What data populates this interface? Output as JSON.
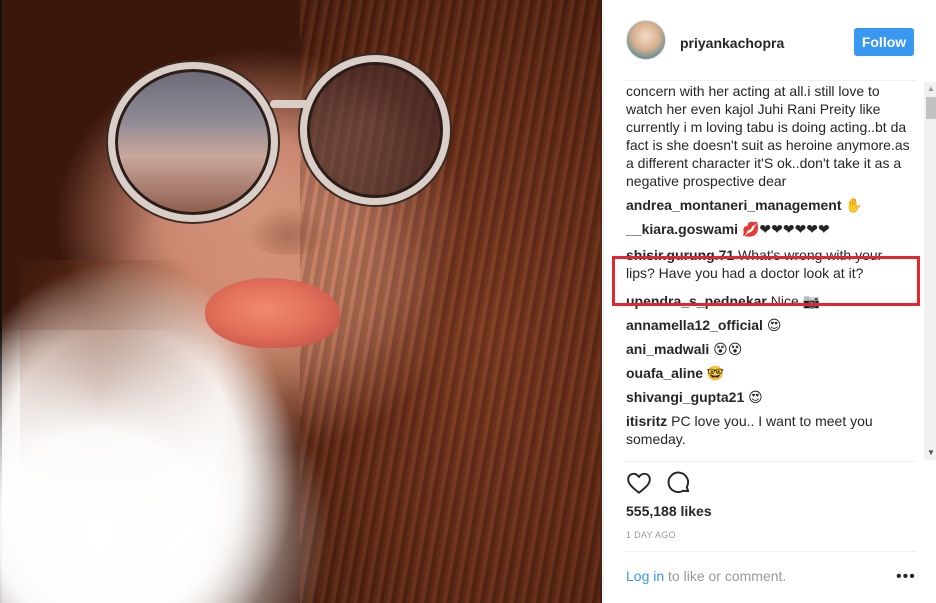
{
  "post": {
    "username": "priyankachopra",
    "follow_label": "Follow",
    "likes": "555,188 likes",
    "timestamp": "1 DAY AGO",
    "footer_login": "Log in",
    "footer_text": " to like or comment.",
    "more_label": "•••"
  },
  "comments": [
    {
      "user": "",
      "text": "concern with her acting at all.i still love to watch her even kajol Juhi Rani Preity like currently i m loving tabu is doing acting..bt da fact is she doesn't suit as heroine anymore.as a different character it'S ok..don't take it as a negative prospective dear"
    },
    {
      "user": "andrea_montaneri_management",
      "text": " ✋"
    },
    {
      "user": "__kiara.goswami",
      "text": " 💋❤❤❤❤❤❤"
    },
    {
      "user": "shisir.gurung.71",
      "text": " What's wrong with your lips? Have you had a doctor look at it?"
    },
    {
      "user": "upendra_s_pednekar",
      "text": " Nice 📷"
    },
    {
      "user": "annamella12_official",
      "text": " 😍"
    },
    {
      "user": "ani_madwali",
      "text": " 😵😵"
    },
    {
      "user": "ouafa_aline",
      "text": " 🤓"
    },
    {
      "user": "shivangi_gupta21",
      "text": " 😍"
    },
    {
      "user": "itisritz",
      "text": " PC love you.. I want to meet you someday."
    }
  ],
  "icons": {
    "like": "heart-icon",
    "comment": "comment-bubble-icon"
  },
  "colors": {
    "follow_button": "#3897f0",
    "highlight": "#e3262f",
    "link": "#3897f0"
  }
}
